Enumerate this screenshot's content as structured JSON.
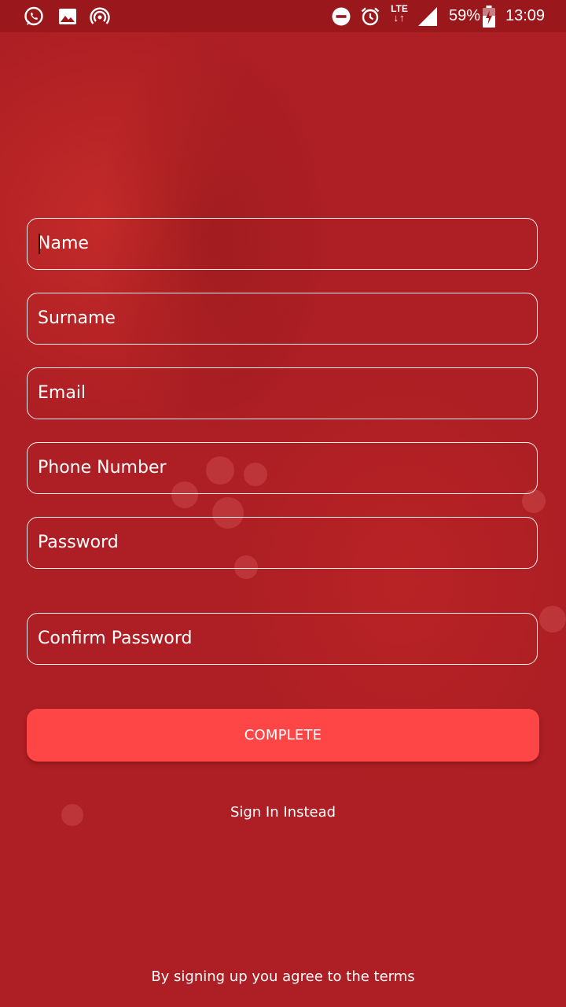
{
  "status_bar": {
    "notification_icons": [
      "whatsapp-icon",
      "gallery-icon",
      "hotspot-icon"
    ],
    "system_icons": [
      "do-not-disturb-icon",
      "alarm-icon",
      "lte-signal-icon",
      "battery-charging-icon"
    ],
    "network_label": "LTE",
    "battery_percent": "59%",
    "time": "13:09"
  },
  "form": {
    "name_placeholder": "Name",
    "surname_placeholder": "Surname",
    "email_placeholder": "Email",
    "phone_placeholder": "Phone Number",
    "password_placeholder": "Password",
    "confirm_password_placeholder": "Confirm Password"
  },
  "actions": {
    "complete_label": "COMPLETE",
    "sign_in_label": "Sign In Instead"
  },
  "footer": {
    "terms_text": "By signing up you agree to the terms"
  },
  "colors": {
    "background": "#ad1f24",
    "status_bar": "#9a181c",
    "button": "#ff4646",
    "text": "#ffffff"
  }
}
